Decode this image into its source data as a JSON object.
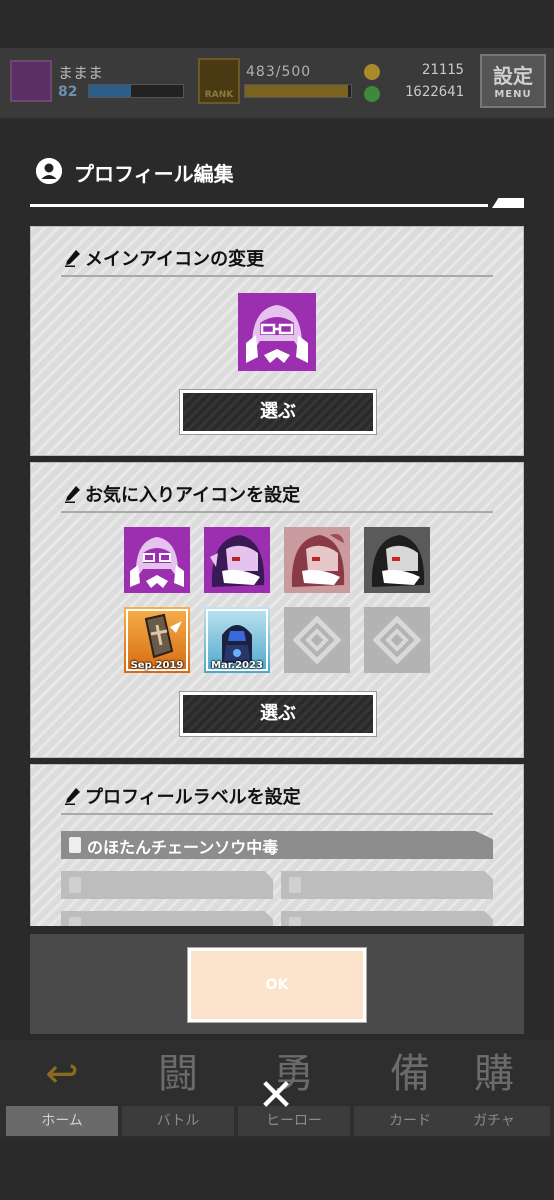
{
  "topbar": {
    "player_name": "ままま",
    "player_level": "82",
    "exp_fraction": 0.45,
    "rank_label": "RANK",
    "rank_count": "483/500",
    "rank_fraction": 0.97,
    "coins": "21115",
    "gems": "1622641",
    "menu_big": "設定",
    "menu_small": "MENU"
  },
  "modal": {
    "title": "プロフィール編集",
    "main_icon_section": {
      "title": "メインアイコンの変更",
      "choose_label": "選ぶ"
    },
    "favorite_section": {
      "title": "お気に入りアイコンを設定",
      "choose_label": "選ぶ",
      "tiles": [
        {
          "name": "purple-hooded-icon",
          "label": ""
        },
        {
          "name": "purple-dark-icon",
          "label": ""
        },
        {
          "name": "pink-red-icon",
          "label": ""
        },
        {
          "name": "gray-dark-icon",
          "label": ""
        },
        {
          "name": "coffin-badge-icon",
          "label": "Sep.2019"
        },
        {
          "name": "blue-armor-badge-icon",
          "label": "Mar.2023"
        },
        {
          "name": "empty-slot-icon",
          "label": ""
        },
        {
          "name": "empty-slot-icon",
          "label": ""
        }
      ]
    },
    "label_section": {
      "title": "プロフィールラベルを設定",
      "selected_label": "のほたんチェーンソウ中毒"
    },
    "ok_label": "OK"
  },
  "nav": [
    {
      "icon": "home-icon",
      "label": "ホーム",
      "glyph": "↩"
    },
    {
      "icon": "battle-icon",
      "label": "バトル",
      "glyph": "闘"
    },
    {
      "icon": "hero-icon",
      "label": "ヒーロー",
      "glyph": "勇"
    },
    {
      "icon": "card-icon",
      "label": "カード",
      "glyph": "備"
    },
    {
      "icon": "gacha-icon",
      "label": "ガチャ",
      "glyph": "購"
    }
  ],
  "close_glyph": "✕",
  "colors": {
    "accent_purple": "#9b2fb0",
    "ok_button": "#fbe3cc"
  }
}
